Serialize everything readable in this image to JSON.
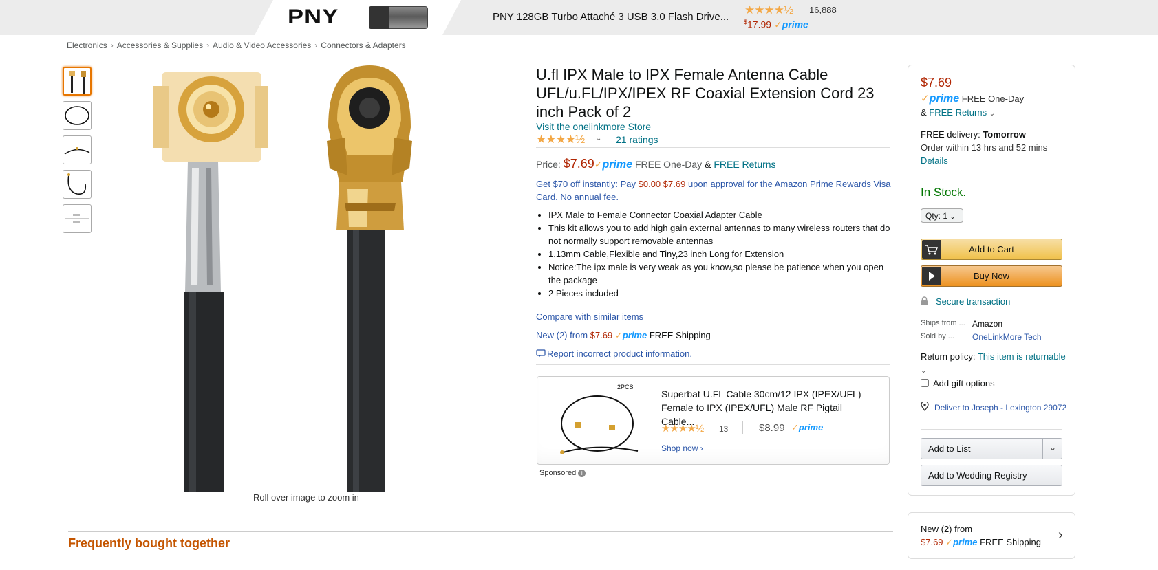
{
  "ad": {
    "brand": "PNY",
    "title": "PNY 128GB Turbo Attaché 3 USB 3.0 Flash Drive...",
    "stars": "★★★★½",
    "rating_count": "16,888",
    "price_symbol": "$",
    "price": "17.99",
    "prime_check": "✓",
    "prime_label": "prime"
  },
  "breadcrumb": [
    "Electronics",
    "Accessories & Supplies",
    "Audio & Video Accessories",
    "Connectors & Adapters"
  ],
  "breadcrumb_sep": "›",
  "gallery": {
    "zoom_hint": "Roll over image to zoom in"
  },
  "product": {
    "title": "U.fl IPX Male to IPX Female Antenna Cable UFL/u.FL/IPX/IPEX RF Coaxial Extension Cord 23 inch Pack of 2",
    "store_link": "Visit the onelinkmore Store",
    "stars": "★★★★½",
    "rating_chevron": "⌄",
    "ratings_link": "21 ratings",
    "price_label": "Price:",
    "price": "$7.69",
    "prime_check": "✓",
    "prime_label": "prime",
    "free_one_day": "FREE One-Day",
    "amp": "&",
    "free_returns": "FREE Returns",
    "promo_start": "Get $70 off instantly: Pay ",
    "promo_pay": "$0.00",
    "promo_was": "$7.69",
    "promo_end": " upon approval for the Amazon Prime Rewards Visa Card. No annual fee.",
    "bullets": [
      "IPX Male to Female Connector Coaxial Adapter Cable",
      "This kit allows you to add high gain external antennas to many wireless routers that do not normally support removable antennas",
      "1.13mm Cable,Flexible and Tiny,23 inch Long for Extension",
      "Notice:The ipx male is very weak as you know,so please be patience when you open the package",
      "2 Pieces included"
    ],
    "compare_link": "Compare with similar items",
    "new_from_label": "New (2) from ",
    "new_from_price": "$7.69",
    "free_shipping": "FREE Shipping",
    "report_link": "Report incorrect product information."
  },
  "sponsored": {
    "image_caption": "2PCS",
    "title": "Superbat U.FL Cable 30cm/12 IPX (IPEX/UFL) Female to IPX (IPEX/UFL) Male RF Pigtail Cable...",
    "stars": "★★★★½",
    "rating_count": "13",
    "price": "$8.99",
    "prime_check": "✓",
    "prime_label": "prime",
    "shop_now": "Shop now ›",
    "label": "Sponsored",
    "info_glyph": "i"
  },
  "buybox": {
    "price": "$7.69",
    "prime_check": "✓",
    "prime_label": "prime",
    "free_one_day": "FREE One-Day",
    "amp": "& ",
    "free_returns": "FREE Returns",
    "returns_chevron": "⌄",
    "delivery_label": "FREE delivery: ",
    "delivery_day": "Tomorrow",
    "order_within": "Order within 13 hrs and 52 mins",
    "details_link": "Details",
    "stock": "In Stock.",
    "qty": "Qty: 1",
    "qty_chevron": "⌄",
    "add_to_cart": "Add to Cart",
    "buy_now": "Buy Now",
    "secure": "Secure transaction",
    "ships_from_label": "Ships from ...",
    "ships_from_value": "Amazon",
    "sold_by_label": "Sold by ...",
    "sold_by_value": "OneLinkMore Tech",
    "return_policy_label": "Return policy: ",
    "return_policy_value": "This item is returnable",
    "return_chevron": "⌄",
    "gift_options": "Add gift options",
    "deliver_to": "Deliver to Joseph - Lexington 29072",
    "add_to_list": "Add to List",
    "list_chevron": "⌄",
    "add_to_wedding": "Add to Wedding Registry"
  },
  "new_box": {
    "line1": "New (2) from",
    "price": "$7.69",
    "prime_check": "✓",
    "prime_label": "prime",
    "free_shipping": "FREE Shipping",
    "arrow": "›"
  },
  "fbt_title": "Frequently bought together",
  "colors": {
    "price_red": "#b12704",
    "link_teal": "#007185",
    "link_blue": "#2a55a8",
    "in_stock_green": "#007600",
    "prime_blue": "#1399ff",
    "star_orange": "#f3a847",
    "fbt_orange": "#c45500"
  }
}
